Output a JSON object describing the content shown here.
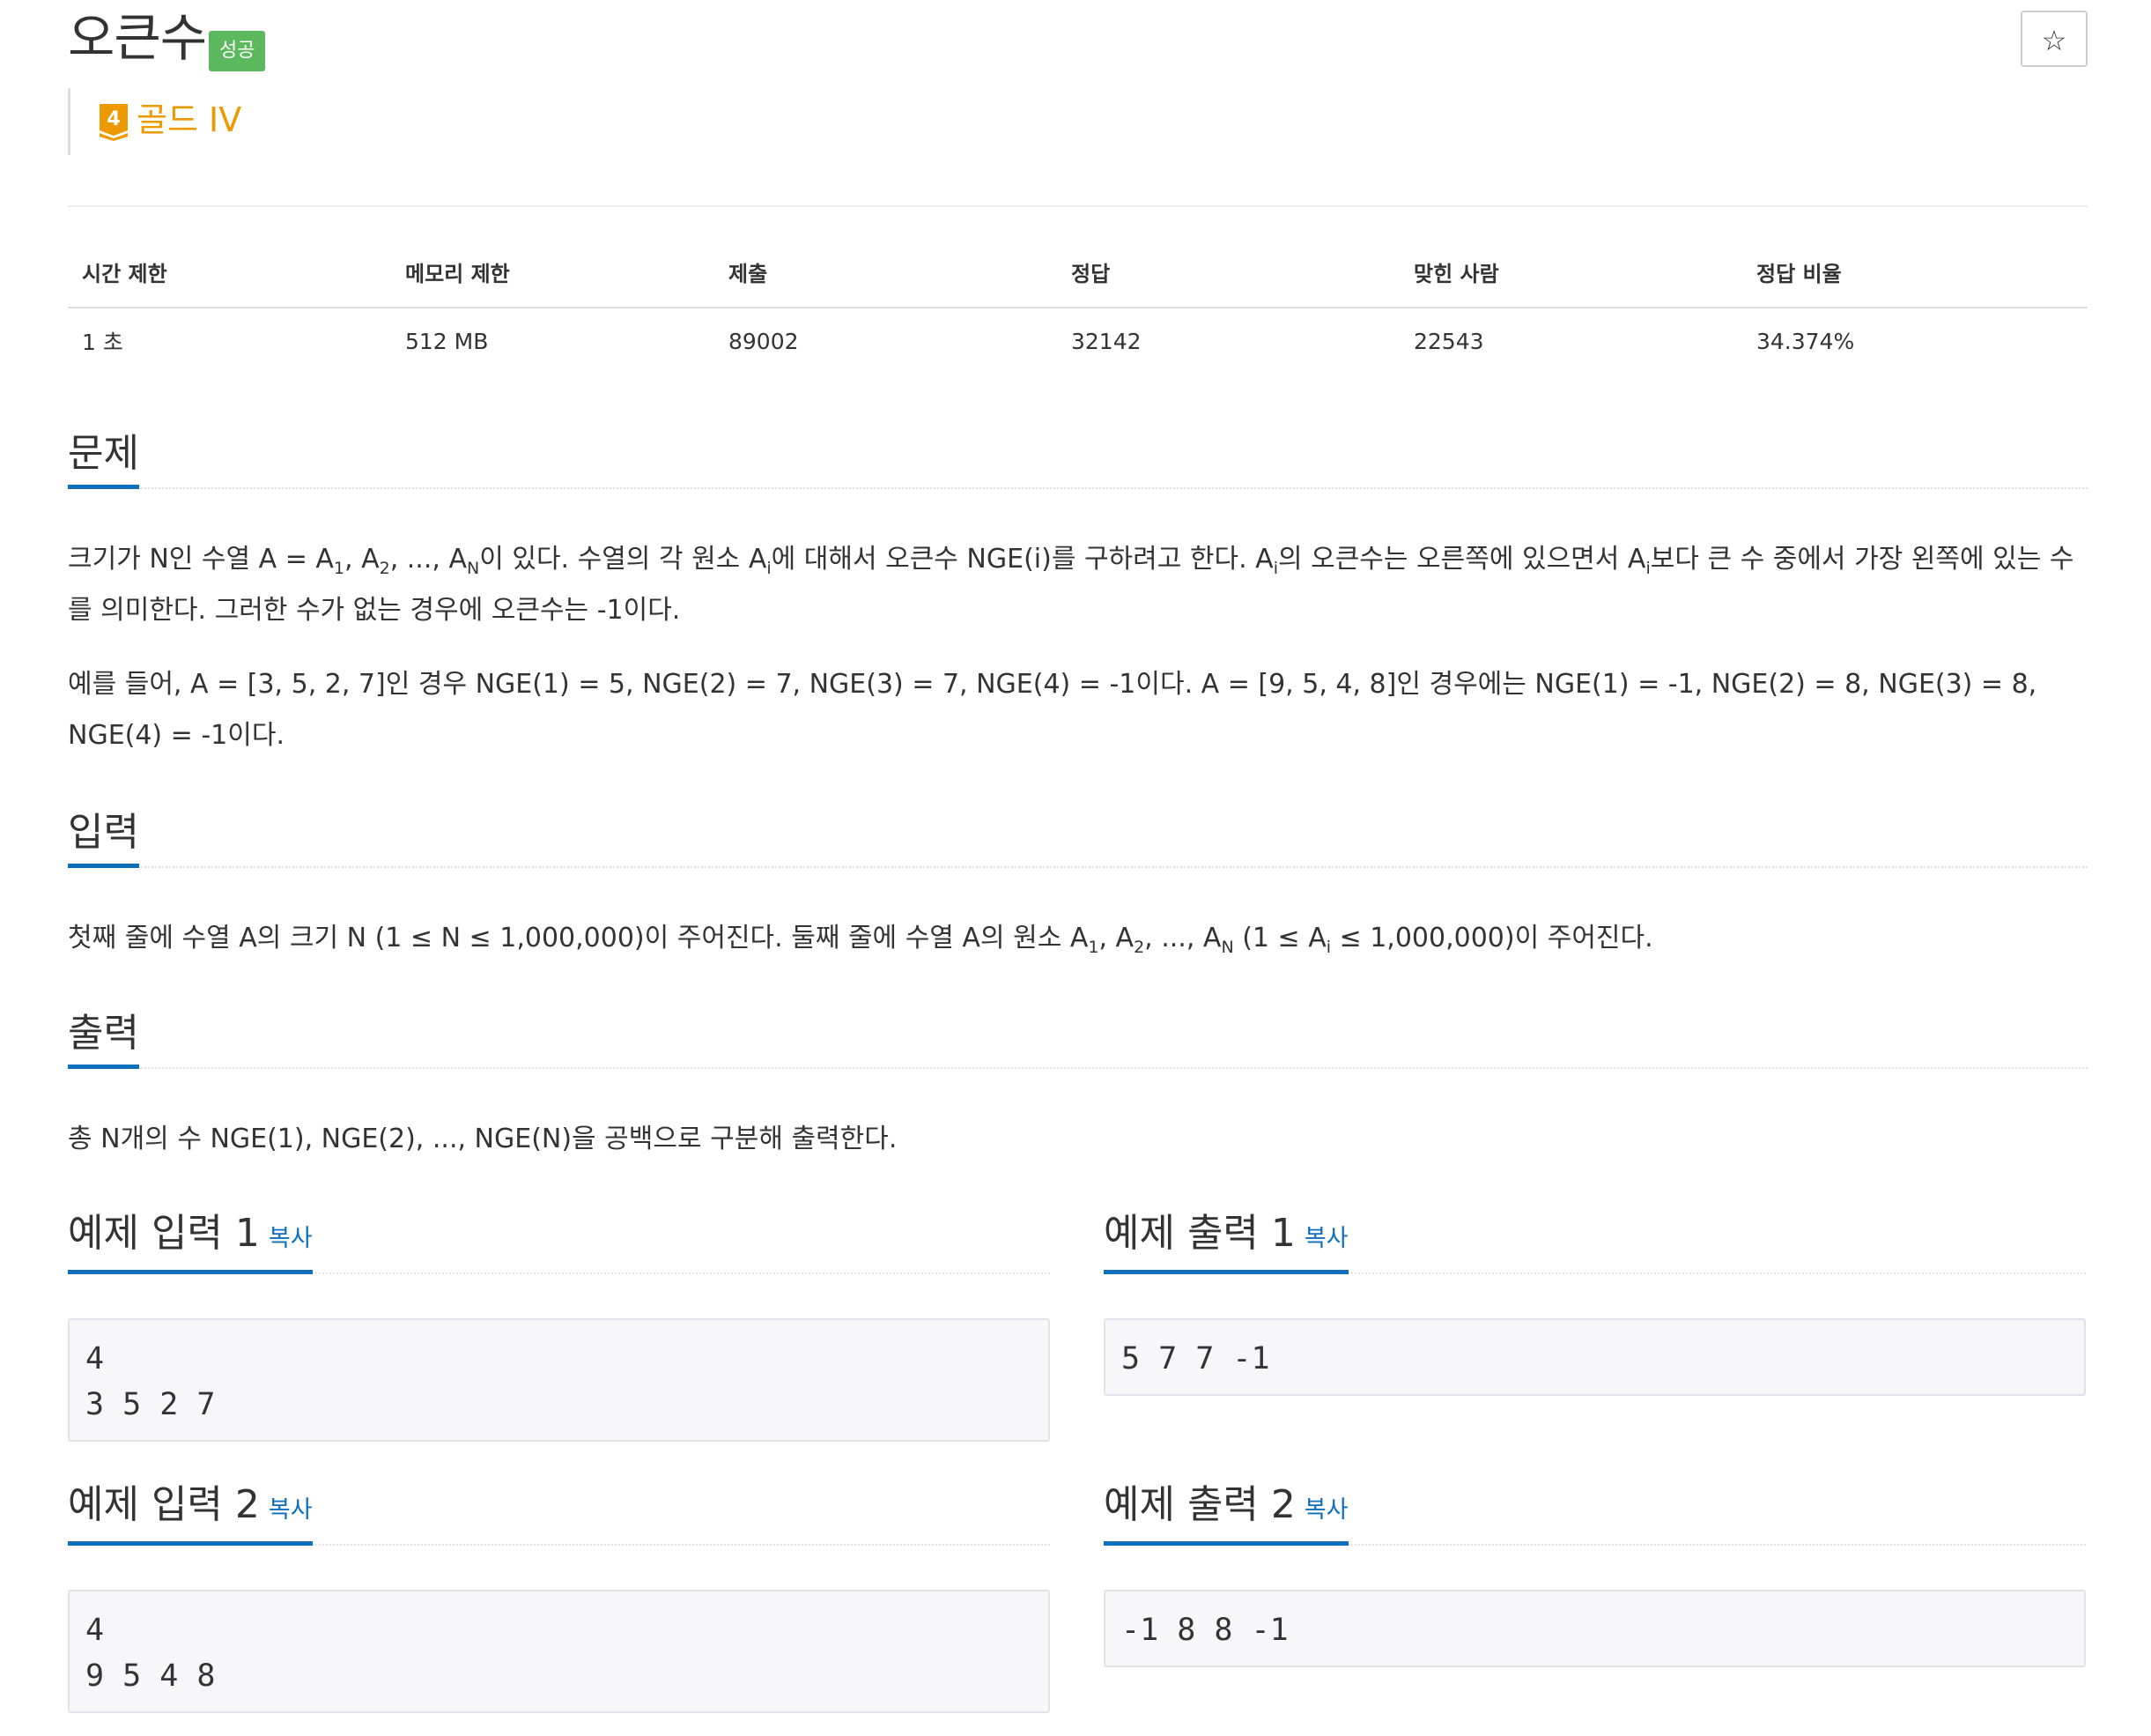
{
  "problem": {
    "title": "오큰수",
    "status_badge": "성공",
    "tier_number": "4",
    "tier_label": "골드 IV",
    "star_label": "☆"
  },
  "stats": {
    "headers": [
      "시간 제한",
      "메모리 제한",
      "제출",
      "정답",
      "맞힌 사람",
      "정답 비율"
    ],
    "values": [
      "1 초",
      "512 MB",
      "89002",
      "32142",
      "22543",
      "34.374%"
    ]
  },
  "sections": {
    "description_title": "문제",
    "input_title": "입력",
    "output_title": "출력"
  },
  "description": {
    "p1_a": "크기가 N인 수열 A = A",
    "p1_s1": "1",
    "p1_b": ", A",
    "p1_s2": "2",
    "p1_c": ", ..., A",
    "p1_s3": "N",
    "p1_d": "이 있다. 수열의 각 원소 A",
    "p1_s4": "i",
    "p1_e": "에 대해서 오큰수 NGE(i)를 구하려고 한다. A",
    "p1_s5": "i",
    "p1_f": "의 오큰수는 오른쪽에 있으면서 A",
    "p1_s6": "i",
    "p1_g": "보다 큰 수 중에서 가장 왼쪽에 있는 수를 의미한다. 그러한 수가 없는 경우에 오큰수는 -1이다.",
    "p2": "예를 들어, A = [3, 5, 2, 7]인 경우 NGE(1) = 5, NGE(2) = 7, NGE(3) = 7, NGE(4) = -1이다. A = [9, 5, 4, 8]인 경우에는 NGE(1) = -1, NGE(2) = 8, NGE(3) = 8, NGE(4) = -1이다."
  },
  "input": {
    "a": "첫째 줄에 수열 A의 크기 N (1 ≤ N ≤ 1,000,000)이 주어진다. 둘째 줄에 수열 A의 원소 A",
    "s1": "1",
    "b": ", A",
    "s2": "2",
    "c": ", ..., A",
    "s3": "N",
    "d": " (1 ≤ A",
    "s4": "i",
    "e": " ≤ 1,000,000)이 주어진다."
  },
  "output": {
    "text": "총 N개의 수 NGE(1), NGE(2), ..., NGE(N)을 공백으로 구분해 출력한다."
  },
  "samples": {
    "copy_label": "복사",
    "input1_title": "예제 입력 1",
    "output1_title": "예제 출력 1",
    "input2_title": "예제 입력 2",
    "output2_title": "예제 출력 2",
    "input1": "4\n3 5 2 7",
    "output1": "5 7 7 -1",
    "input2": "4\n9 5 4 8",
    "output2": "-1 8 8 -1"
  },
  "colors": {
    "success": "#5cb85c",
    "gold_tier": "#ec9a00",
    "link_blue": "#0e6fbd"
  }
}
